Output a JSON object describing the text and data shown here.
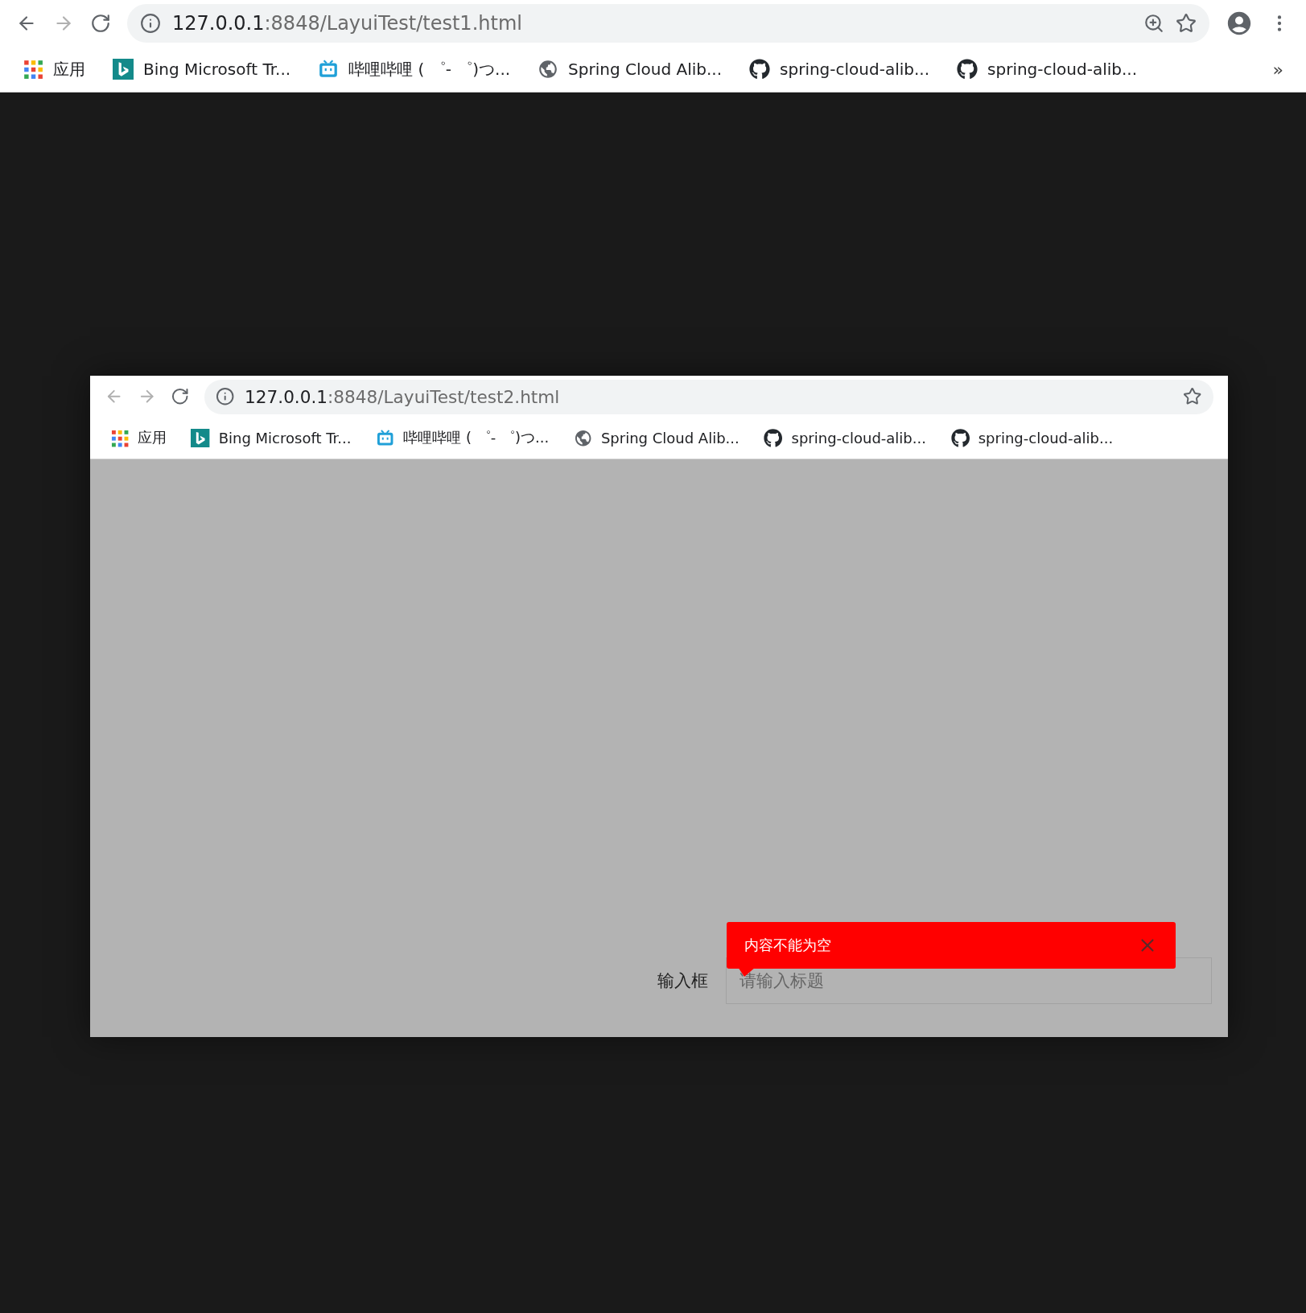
{
  "outer_browser": {
    "back": {
      "disabled": false
    },
    "forward": {
      "disabled": true
    },
    "address": {
      "host": "127.0.0.1",
      "path": ":8848/LayuiTest/test1.html"
    },
    "address_actions": [
      {
        "kind": "zoom"
      },
      {
        "kind": "star"
      }
    ],
    "toolbar_actions": [
      {
        "kind": "profile"
      },
      {
        "kind": "menu"
      }
    ],
    "bookmarks": [
      {
        "kind": "apps",
        "label": "应用"
      },
      {
        "kind": "bing",
        "label": "Bing Microsoft Tr..."
      },
      {
        "kind": "bilibili",
        "label": "哔哩哔哩 ( ゜- ゜)つ..."
      },
      {
        "kind": "globe",
        "label": "Spring Cloud Alib..."
      },
      {
        "kind": "github",
        "label": "spring-cloud-alib..."
      },
      {
        "kind": "github",
        "label": "spring-cloud-alib..."
      }
    ],
    "overflow": "»"
  },
  "inner_browser": {
    "back": {
      "disabled": true
    },
    "forward": {
      "disabled": true
    },
    "address": {
      "host": "127.0.0.1",
      "path": ":8848/LayuiTest/test2.html"
    },
    "address_actions": [
      {
        "kind": "star"
      }
    ],
    "bookmarks": [
      {
        "kind": "apps",
        "label": "应用"
      },
      {
        "kind": "bing",
        "label": "Bing Microsoft Tr..."
      },
      {
        "kind": "bilibili",
        "label": "哔哩哔哩 ( ゜- ゜)つ..."
      },
      {
        "kind": "globe",
        "label": "Spring Cloud Alib..."
      },
      {
        "kind": "github",
        "label": "spring-cloud-alib..."
      },
      {
        "kind": "github",
        "label": "spring-cloud-alib..."
      }
    ]
  },
  "form": {
    "label": "输入框",
    "placeholder": "请输入标题"
  },
  "tooltip": {
    "message": "内容不能为空"
  }
}
